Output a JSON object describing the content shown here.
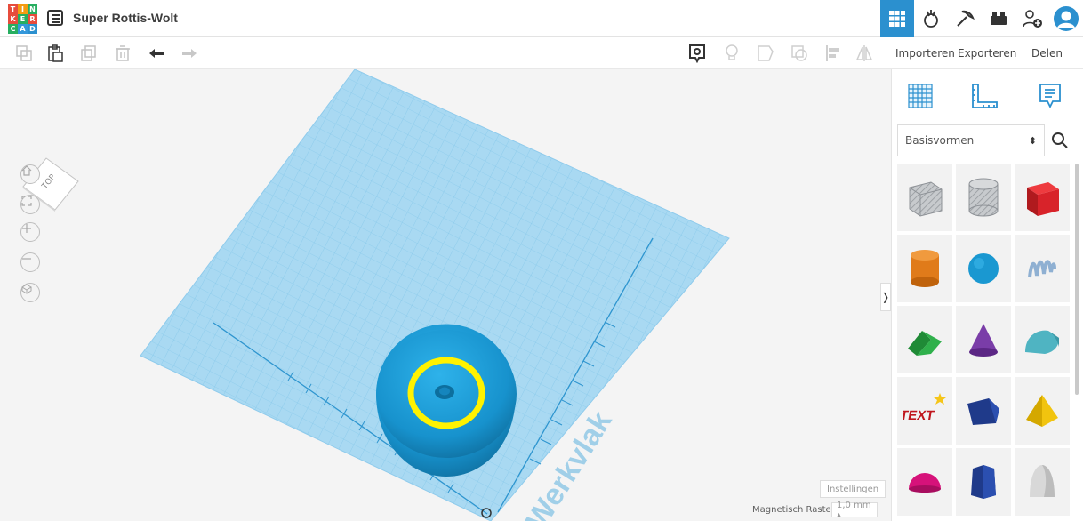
{
  "app": {
    "logo_letters": [
      "T",
      "I",
      "N",
      "K",
      "E",
      "R",
      "C",
      "A",
      "D"
    ],
    "logo_colors": [
      "#e74c3c",
      "#f39c12",
      "#27ae60",
      "#e74c3c",
      "#27ae60",
      "#e74c3c",
      "#27ae60",
      "#3498db",
      "#2b90cf"
    ],
    "design_title": "Super Rottis-Wolt",
    "accent_color": "#2b90cf"
  },
  "topbar_buttons": [
    {
      "name": "3d-design-view-icon",
      "active": true
    },
    {
      "name": "codeblocks-icon",
      "active": false
    },
    {
      "name": "pickaxe-icon",
      "active": false
    },
    {
      "name": "lego-brick-icon",
      "active": false
    },
    {
      "name": "add-user-icon",
      "active": false
    },
    {
      "name": "profile-avatar-icon",
      "active": false
    }
  ],
  "toolbar": {
    "left_tools": [
      "copy-icon",
      "paste-icon",
      "duplicate-icon",
      "delete-icon",
      "undo-icon",
      "redo-icon"
    ],
    "right_tools": [
      "notes-icon",
      "light-bulb-icon",
      "group-icon",
      "ungroup-icon",
      "align-icon",
      "mirror-icon"
    ],
    "import_label": "Importeren",
    "export_label": "Exporteren",
    "share_label": "Delen"
  },
  "viewport": {
    "navcube_label": "TOP",
    "nav_buttons": [
      "home-view-icon",
      "fit-view-icon",
      "zoom-in-icon",
      "zoom-out-icon",
      "perspective-icon"
    ],
    "workplane_label": "Werkvlak",
    "workplane_color": "#a9d9f2",
    "object_color": "#1a98d1",
    "highlight_color": "#fff200",
    "settings_label": "Instellingen",
    "snap_label": "Magnetisch Raster",
    "snap_value": "1,0 mm ▴",
    "panel_toggle": "❭"
  },
  "panel": {
    "tools": [
      "workplane-icon",
      "ruler-icon",
      "notes-panel-icon"
    ],
    "library": "Basisvormen",
    "library_chevron": "⬍",
    "shapes": [
      {
        "name": "box-hole-shape",
        "color": "#bfc3c7"
      },
      {
        "name": "cylinder-hole-shape",
        "color": "#bfc3c7"
      },
      {
        "name": "box-shape",
        "color": "#d8232a"
      },
      {
        "name": "cylinder-shape",
        "color": "#e07b1a"
      },
      {
        "name": "sphere-shape",
        "color": "#1a98d1"
      },
      {
        "name": "scribble-shape",
        "color": "#8fb0d2"
      },
      {
        "name": "roof-shape",
        "color": "#2aa042"
      },
      {
        "name": "cone-shape",
        "color": "#7a3da8"
      },
      {
        "name": "round-roof-shape",
        "color": "#4fb4c2"
      },
      {
        "name": "text-shape",
        "color": "#c0161d",
        "label": "TEXT"
      },
      {
        "name": "wedge-shape",
        "color": "#1f3a8a"
      },
      {
        "name": "pyramid-shape",
        "color": "#f1c40f"
      },
      {
        "name": "half-sphere-shape",
        "color": "#d6127a"
      },
      {
        "name": "polygon-shape",
        "color": "#1f3a8a"
      },
      {
        "name": "paraboloid-shape",
        "color": "#d8d8d8"
      }
    ]
  }
}
